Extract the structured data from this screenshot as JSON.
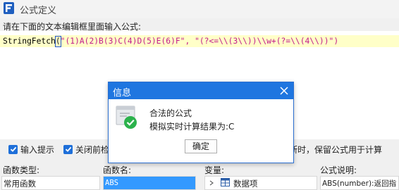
{
  "window": {
    "title": "公式定义"
  },
  "instruction": "请在下面的文本编辑框里面输入公式:",
  "formula": {
    "function_name": "StringFetch",
    "open_paren": "(",
    "arguments": "\"(1)A(2)B(3)C(4)D(5)E(6)F\", \"(?<=\\\\(3\\\\))\\\\w+(?=\\\\(4\\\\))\")"
  },
  "options": {
    "input_hint": {
      "label": "输入提示",
      "checked": true
    },
    "close_preview": {
      "label": "关闭前检",
      "checked": true
    },
    "keep_formula": {
      "label": "断时，保留公式用于计算"
    }
  },
  "columns": {
    "function_type": {
      "header": "函数类型:",
      "selected": "常用函数"
    },
    "function_name": {
      "header": "函数名:",
      "selected": "ABS"
    },
    "variable": {
      "header": "变量:",
      "item": "数据项"
    },
    "description": {
      "header": "公式说明:",
      "text": "ABS(number):返回指"
    }
  },
  "dialog": {
    "title": "信息",
    "message": "合法的公式",
    "result": "模拟实时计算结果为:C",
    "ok_label": "确定"
  },
  "colors": {
    "accent": "#1f76e0",
    "selection": "#3399ff",
    "string_args": "#c21c8c",
    "success": "#2bb24c"
  }
}
